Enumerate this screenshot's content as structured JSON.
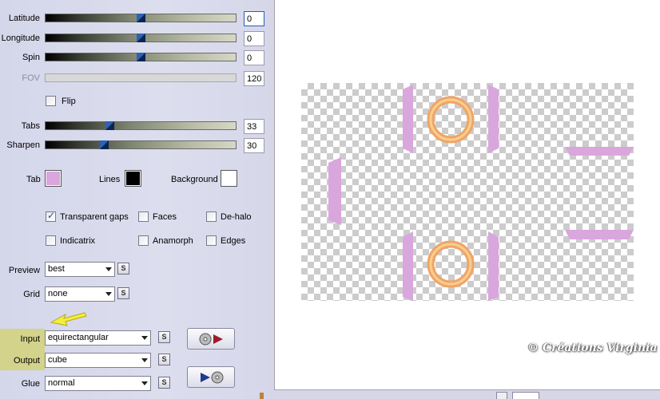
{
  "sliders": {
    "latitude": {
      "label": "Latitude",
      "value": "0",
      "level": 0.5
    },
    "longitude": {
      "label": "Longitude",
      "value": "0",
      "level": 0.5
    },
    "spin": {
      "label": "Spin",
      "value": "0",
      "level": 0.5
    },
    "fov": {
      "label": "FOV",
      "value": "120",
      "level": 0
    },
    "tabs": {
      "label": "Tabs",
      "value": "33",
      "level": 0.33
    },
    "sharpen": {
      "label": "Sharpen",
      "value": "30",
      "level": 0.3
    }
  },
  "flip": {
    "label": "Flip",
    "checked": false
  },
  "colors": {
    "tab": {
      "label": "Tab",
      "color": "#d9a6dd"
    },
    "lines": {
      "label": "Lines",
      "color": "#000000"
    },
    "background": {
      "label": "Background",
      "color": "#ffffff"
    }
  },
  "options": {
    "transparent_gaps": {
      "label": "Transparent gaps",
      "checked": true
    },
    "faces": {
      "label": "Faces",
      "checked": false
    },
    "de_halo": {
      "label": "De-halo",
      "checked": false
    },
    "indicatrix": {
      "label": "Indicatrix",
      "checked": false
    },
    "anamorph": {
      "label": "Anamorph",
      "checked": false
    },
    "edges": {
      "label": "Edges",
      "checked": false
    }
  },
  "selects": {
    "preview": {
      "label": "Preview",
      "value": "best"
    },
    "grid": {
      "label": "Grid",
      "value": "none"
    },
    "input": {
      "label": "Input",
      "value": "equirectangular"
    },
    "output": {
      "label": "Output",
      "value": "cube"
    },
    "glue": {
      "label": "Glue",
      "value": "normal"
    }
  },
  "s_button_label": "S",
  "watermark": "© Créations Virginia",
  "preview_colors": {
    "tab": "#d9a6dd",
    "ring_outer": "#f0a46a",
    "ring_inner": "#f7d08a"
  }
}
